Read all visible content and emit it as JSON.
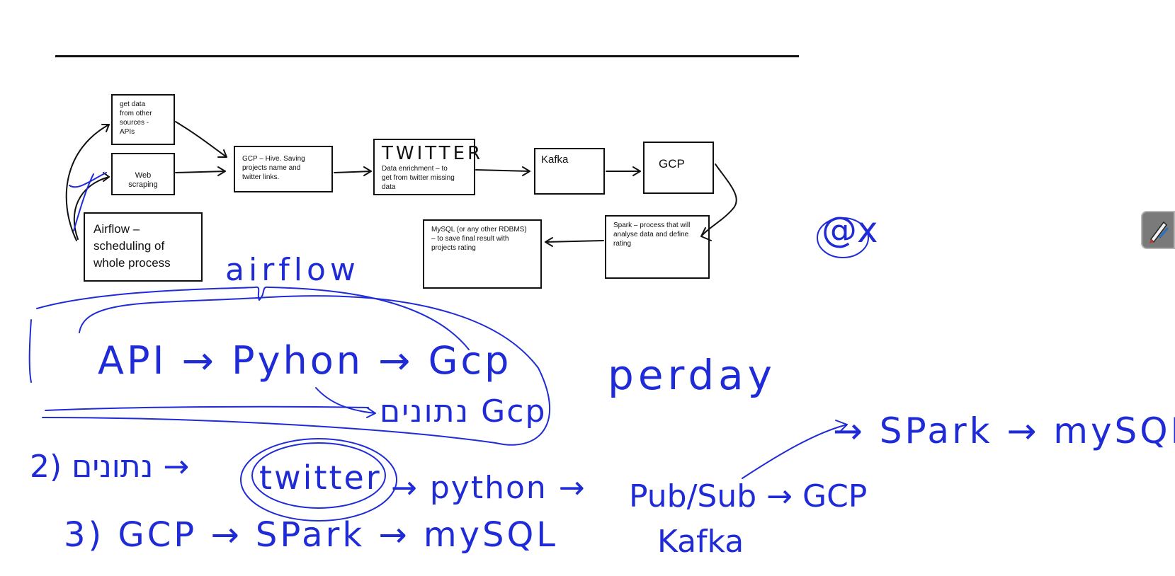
{
  "diagram": {
    "boxes": {
      "apis": "get data\nfrom other\nsources -\nAPIs",
      "web_scraping": "Web scraping",
      "airflow": "Airflow –\nscheduling of\nwhole process",
      "gcp_hive": "GCP – Hive. Saving\nprojects name and\ntwitter links.",
      "twitter_title": "TWITTER",
      "twitter_body": "Data enrichment – to\nget from twitter missing\ndata",
      "kafka": "Kafka",
      "gcp": "GCP",
      "spark": "Spark – process that will\nanalyse data and define\nrating",
      "mysql": "MySQL (or any other RDBMS)\n– to save final result with\nprojects rating"
    }
  },
  "annotations": {
    "airflow": "airflow",
    "line1": "API → Pyhon → Gcp",
    "line1_sub": "נתונים Gcp",
    "perday": "perday",
    "at_x": "@x",
    "line2_prefix": "2) נתונים →",
    "line2_twitter": "twitter",
    "line2_python": "→ python →",
    "line2_pubsub": "Pub/Sub → GCP",
    "kafka": "Kafka",
    "spark_mysql": "→ SPark → mySQL",
    "line3": "3) GCP → SPark → mySQL"
  },
  "colors": {
    "ink": "#1f2bd6",
    "box_border": "#111111"
  },
  "icons": {
    "tool": "pen-icon"
  }
}
